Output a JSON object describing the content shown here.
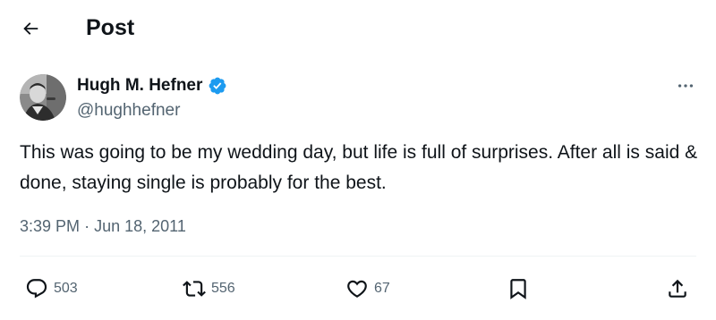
{
  "header": {
    "back_icon": "arrow-left-icon",
    "title": "Post"
  },
  "author": {
    "display_name": "Hugh M. Hefner",
    "handle": "@hughhefner",
    "verified_icon": "verified-badge-icon",
    "verified_color": "#1d9bf0"
  },
  "post": {
    "text": "This was going to be my wedding day, but life is full of surprises. After all is said & done, staying single is probably for the best.",
    "time": "3:39 PM",
    "separator": "·",
    "date": "Jun 18, 2011"
  },
  "actions": {
    "replies": "503",
    "reposts": "556",
    "likes": "67",
    "reply_icon": "reply-icon",
    "repost_icon": "repost-icon",
    "like_icon": "heart-icon",
    "bookmark_icon": "bookmark-icon",
    "share_icon": "share-icon"
  },
  "colors": {
    "text_primary": "#0f1419",
    "text_secondary": "#536471",
    "divider": "#eff3f4"
  }
}
